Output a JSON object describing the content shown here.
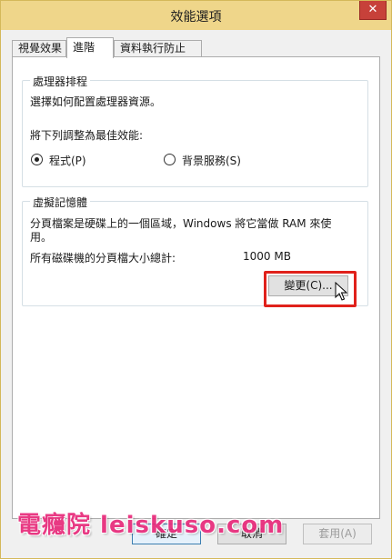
{
  "window": {
    "title": "效能選項",
    "close_glyph": "✕"
  },
  "tabs": [
    {
      "label": "視覺效果",
      "active": false
    },
    {
      "label": "進階",
      "active": true
    },
    {
      "label": "資料執行防止",
      "active": false
    }
  ],
  "processor_group": {
    "label": "處理器排程",
    "description": "選擇如何配置處理器資源。",
    "adjust_label": "將下列調整為最佳效能:",
    "options": [
      {
        "label": "程式(P)",
        "selected": true
      },
      {
        "label": "背景服務(S)",
        "selected": false
      }
    ]
  },
  "virtual_memory_group": {
    "label": "虛擬記憶體",
    "description_line1": "分頁檔案是硬碟上的一個區域，Windows 將它當做 RAM 來使",
    "description_line2": "用。",
    "total_label": "所有磁碟機的分頁檔大小總計:",
    "total_value": "1000 MB",
    "change_button": "變更(C)..."
  },
  "footer": {
    "ok_button": "確定",
    "cancel_button": "取消",
    "apply_button": "套用(A)"
  },
  "watermark": "電癮院 leiskuso.com",
  "colors": {
    "highlight": "#e0211b",
    "titlebar": "#efd68a",
    "close_button": "#c7413a",
    "watermark": "#e82a7a"
  },
  "icons": {
    "cursor": "arrow-cursor-icon",
    "close": "close-icon"
  }
}
